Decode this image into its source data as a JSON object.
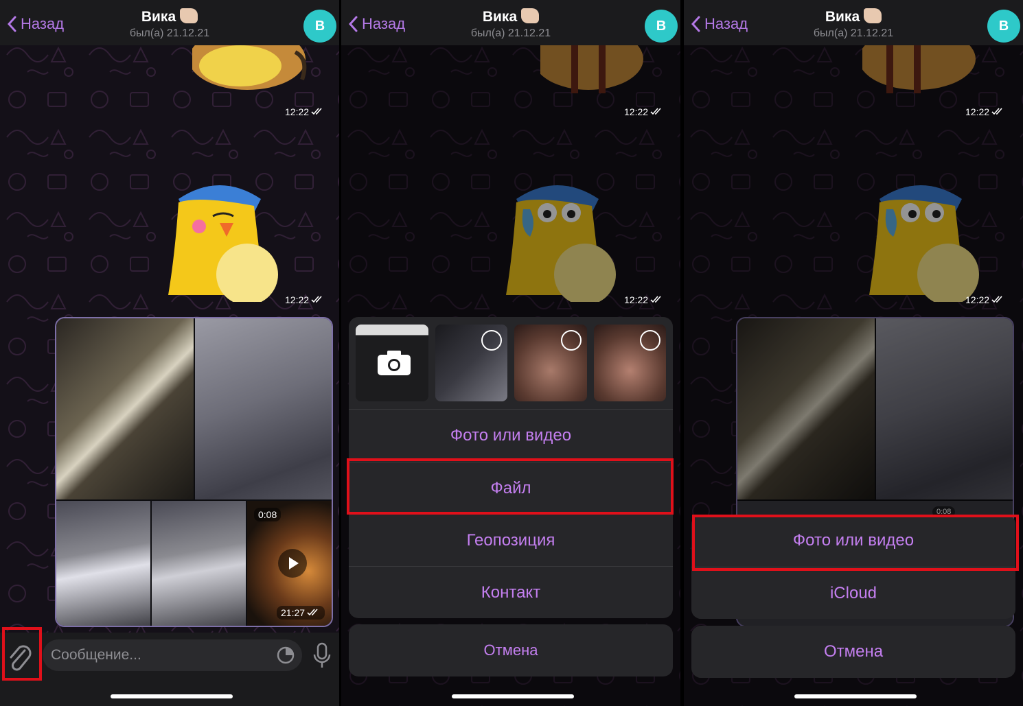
{
  "header": {
    "back_label": "Назад",
    "contact_name": "Вика",
    "status": "был(а) 21.12.21",
    "avatar_letter": "В",
    "accent_color": "#b479e6",
    "avatar_color": "#2ec9c9"
  },
  "messages": {
    "sticker1_time": "12:22",
    "sticker2_time": "12:22",
    "video_duration": "0:08",
    "album_time": "21:27",
    "video_duration_partial": "0:08"
  },
  "input": {
    "placeholder": "Сообщение..."
  },
  "attach_sheet": {
    "items": [
      "Фото или видео",
      "Файл",
      "Геопозиция",
      "Контакт"
    ],
    "cancel": "Отмена"
  },
  "file_sheet": {
    "items": [
      "Фото или видео",
      "iCloud"
    ],
    "cancel": "Отмена"
  },
  "highlight_color": "#e0101a"
}
